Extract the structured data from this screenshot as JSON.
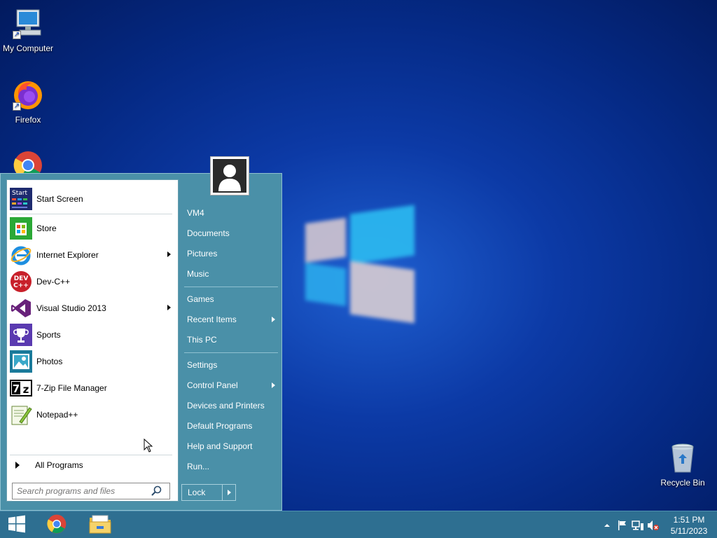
{
  "desktop": {
    "icons": [
      {
        "label": "My Computer",
        "icon": "computer-icon"
      },
      {
        "label": "Firefox",
        "icon": "firefox-icon"
      },
      {
        "label": "",
        "icon": "chrome-icon"
      },
      {
        "label": "Recycle Bin",
        "icon": "recycle-bin-icon"
      }
    ]
  },
  "start_menu": {
    "programs": [
      {
        "label": "Start Screen",
        "icon": "start-screen-icon",
        "submenu": false
      },
      {
        "label": "Store",
        "icon": "store-icon",
        "submenu": false
      },
      {
        "label": "Internet Explorer",
        "icon": "internet-explorer-icon",
        "submenu": true
      },
      {
        "label": "Dev-C++",
        "icon": "devcpp-icon",
        "submenu": false
      },
      {
        "label": "Visual Studio 2013",
        "icon": "visual-studio-icon",
        "submenu": true
      },
      {
        "label": "Sports",
        "icon": "trophy-icon",
        "submenu": false
      },
      {
        "label": "Photos",
        "icon": "photos-icon",
        "submenu": false
      },
      {
        "label": "7-Zip File Manager",
        "icon": "7zip-icon",
        "submenu": false
      },
      {
        "label": "Notepad++",
        "icon": "notepadpp-icon",
        "submenu": false
      }
    ],
    "all_programs": "All Programs",
    "search_placeholder": "Search programs and files",
    "right_items": [
      {
        "label": "VM4",
        "submenu": false
      },
      {
        "label": "Documents",
        "submenu": false
      },
      {
        "label": "Pictures",
        "submenu": false
      },
      {
        "label": "Music",
        "submenu": false
      },
      {
        "label": "Games",
        "submenu": false
      },
      {
        "label": "Recent Items",
        "submenu": true
      },
      {
        "label": "This PC",
        "submenu": false
      },
      {
        "label": "Settings",
        "submenu": false
      },
      {
        "label": "Control Panel",
        "submenu": true
      },
      {
        "label": "Devices and Printers",
        "submenu": false
      },
      {
        "label": "Default Programs",
        "submenu": false
      },
      {
        "label": "Help and Support",
        "submenu": false
      },
      {
        "label": "Run...",
        "submenu": false
      }
    ],
    "lock_label": "Lock",
    "start_tile_text": "Start"
  },
  "taskbar": {
    "time": "1:51 PM",
    "date": "5/11/2023",
    "pinned": [
      "windows-start-icon",
      "chrome-icon",
      "file-explorer-icon"
    ]
  },
  "colors": {
    "menu_bg": "#4a90a8",
    "taskbar_bg": "#2e6f91",
    "desktop_bg": "#0c3aa6"
  }
}
